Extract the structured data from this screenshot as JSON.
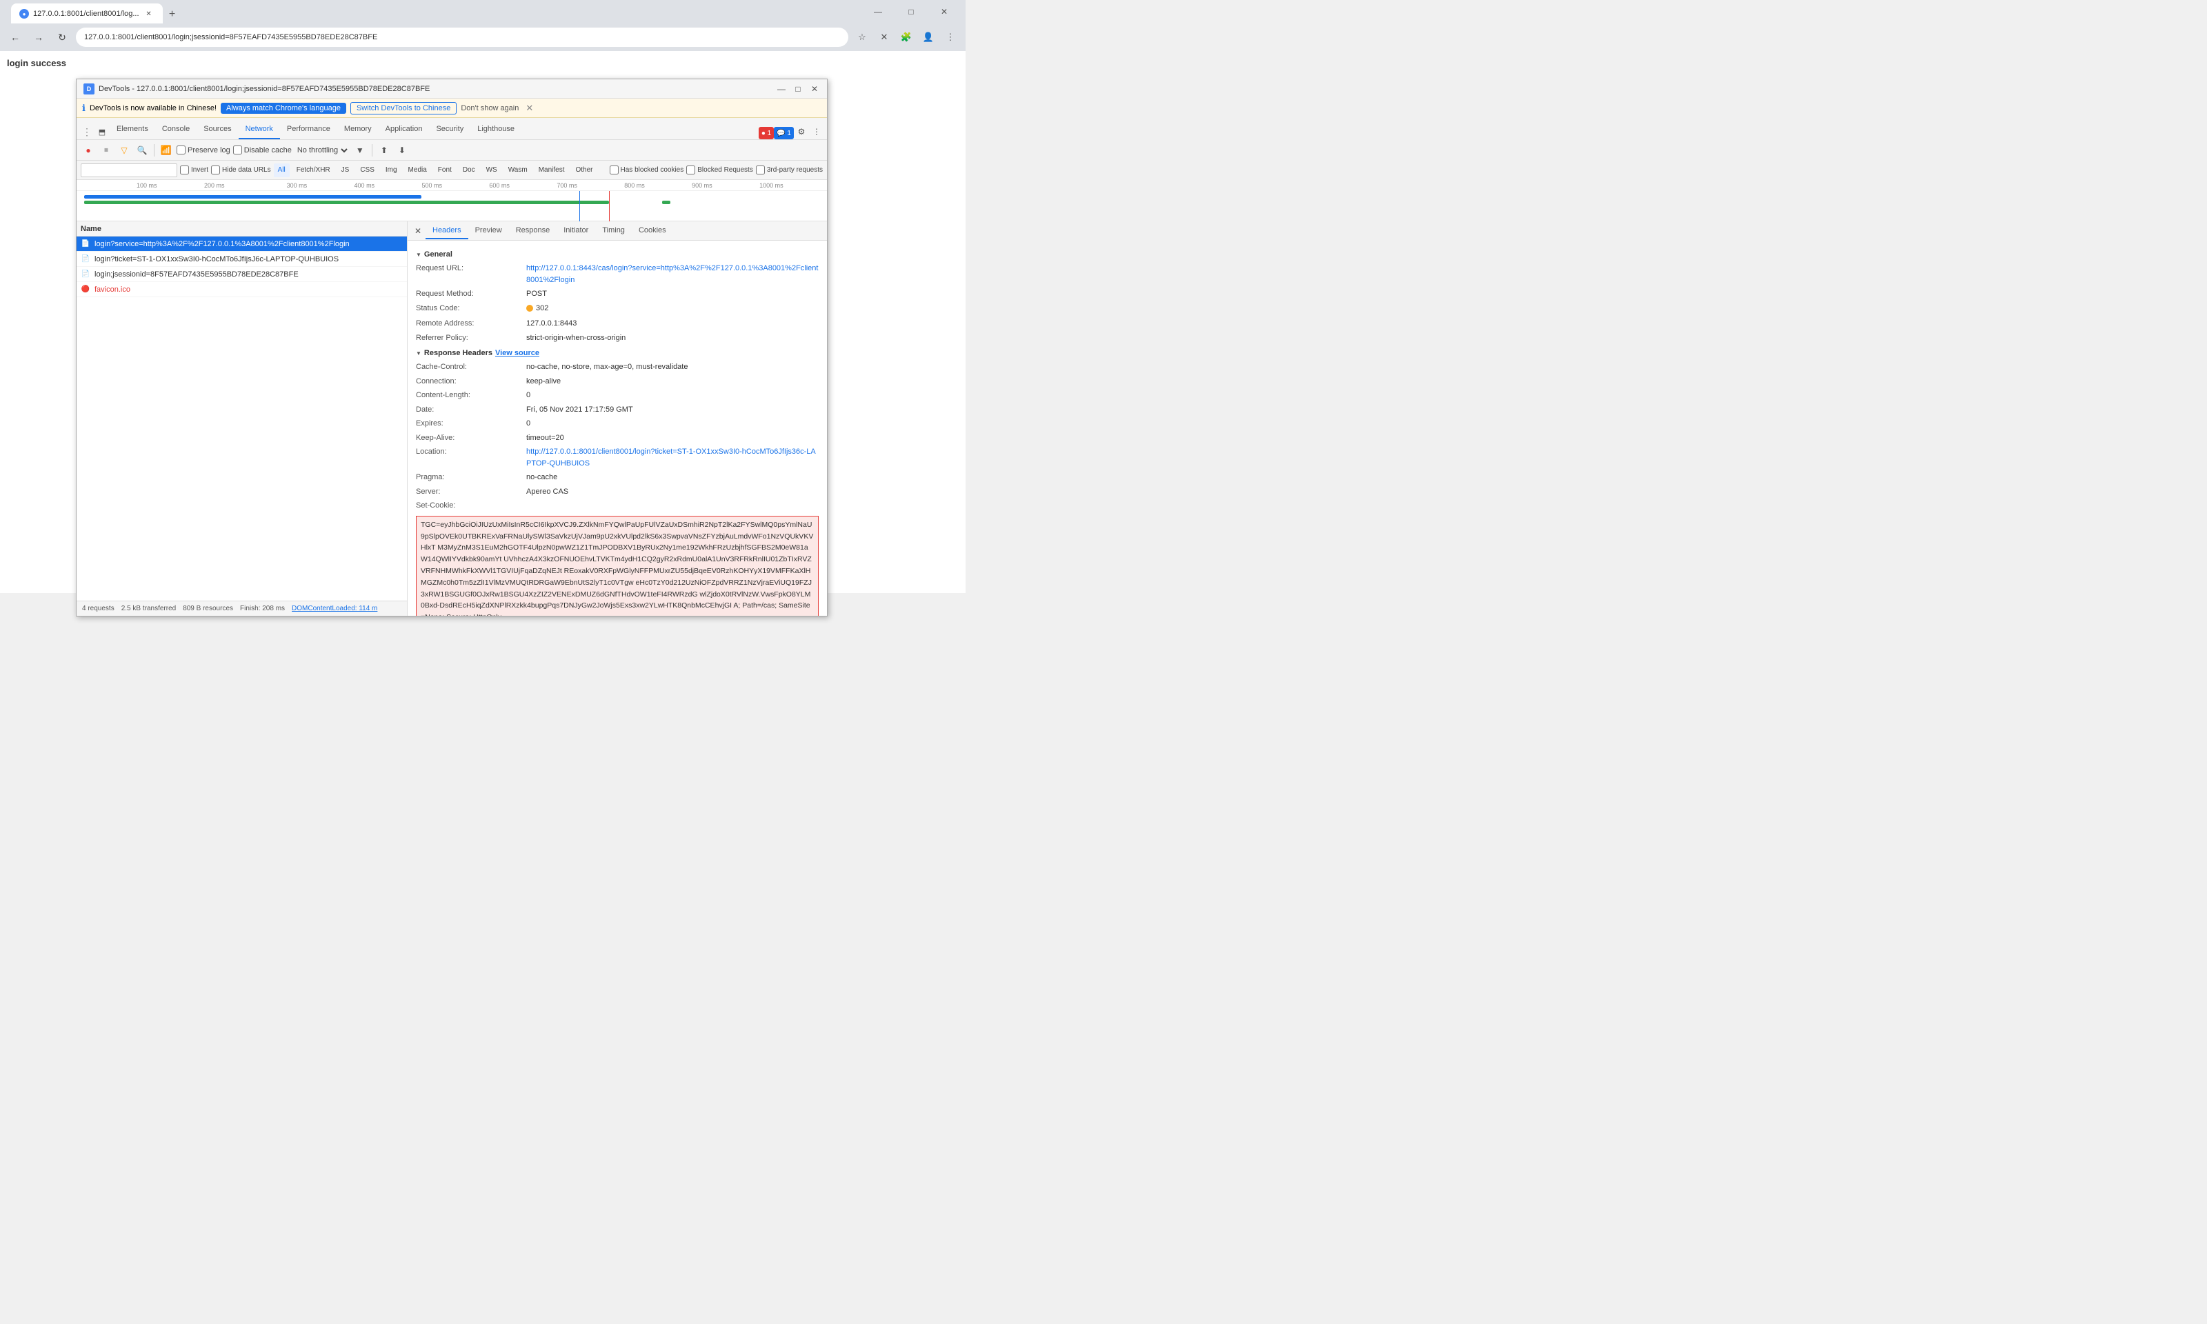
{
  "browser": {
    "tab_title": "127.0.0.1:8001/client8001/log...",
    "tab_favicon": "●",
    "address": "127.0.0.1:8001/client8001/login;jsessionid=8F57EAFD7435E5955BD78EDE28C87BFE",
    "nav_back": "←",
    "nav_forward": "→",
    "nav_reload": "↻",
    "new_tab": "+"
  },
  "page": {
    "login_success": "login success"
  },
  "devtools": {
    "title": "DevTools - 127.0.0.1:8001/client8001/login;jsessionid=8F57EAFD7435E5955BD78EDE28C87BFE",
    "lang_banner": {
      "icon": "ℹ",
      "text": "DevTools is now available in Chinese!",
      "btn1": "Always match Chrome's language",
      "btn2": "Switch DevTools to Chinese",
      "dismiss": "Don't show again"
    },
    "tabs": [
      "Elements",
      "Console",
      "Sources",
      "Network",
      "Performance",
      "Memory",
      "Application",
      "Security",
      "Lighthouse"
    ],
    "active_tab": "Network",
    "toolbar": {
      "record_tooltip": "Stop recording network log",
      "clear_tooltip": "Clear",
      "filter_tooltip": "Filter",
      "search_tooltip": "Search",
      "preserve_log": "Preserve log",
      "disable_cache": "Disable cache",
      "throttle": "No throttling",
      "import_tooltip": "Import HAR file",
      "export_tooltip": "Export HAR file"
    },
    "filter": {
      "placeholder": "",
      "invert": "Invert",
      "hide_data_urls": "Hide data URLs",
      "all": "All",
      "fetch_xhr": "Fetch/XHR",
      "js": "JS",
      "css": "CSS",
      "img": "Img",
      "media": "Media",
      "font": "Font",
      "doc": "Doc",
      "ws": "WS",
      "wasm": "Wasm",
      "manifest": "Manifest",
      "other": "Other",
      "has_blocked": "Has blocked cookies",
      "blocked_requests": "Blocked Requests",
      "third_party": "3rd-party requests"
    },
    "timeline": {
      "ticks": [
        "100 ms",
        "200 ms",
        "300 ms",
        "400 ms",
        "500 ms",
        "600 ms",
        "700 ms",
        "800 ms",
        "900 ms",
        "1000 ms"
      ]
    },
    "requests": [
      {
        "icon_type": "doc",
        "name": "login?service=http%3A%2F%2F127.0.0.1%3A8001%2Fclient8001%2Flogin",
        "selected": true
      },
      {
        "icon_type": "doc",
        "name": "login?ticket=ST-1-OX1xxSw3I0-hCocMTo6JfIjsJ6c-LAPTOP-QUHBUIOS",
        "selected": false
      },
      {
        "icon_type": "doc",
        "name": "login;jsessionid=8F57EAFD7435E5955BD78EDE28C87BFE",
        "selected": false
      },
      {
        "icon_type": "favicon",
        "name": "favicon.ico",
        "selected": false
      }
    ],
    "status_bar": {
      "requests": "4 requests",
      "transferred": "2.5 kB transferred",
      "resources": "809 B resources",
      "finish": "Finish: 208 ms",
      "dom_content": "DOMContentLoaded: 114 m"
    },
    "details": {
      "tabs": [
        "Headers",
        "Preview",
        "Response",
        "Initiator",
        "Timing",
        "Cookies"
      ],
      "active_tab": "Headers",
      "general": {
        "title": "General",
        "request_url_label": "Request URL:",
        "request_url_value": "http://127.0.0.1:8443/cas/login?service=http%3A%2F%2F127.0.0.1%3A8001%2Fclient8001%2Flogin",
        "method_label": "Request Method:",
        "method_value": "POST",
        "status_label": "Status Code:",
        "status_value": "302",
        "remote_label": "Remote Address:",
        "remote_value": "127.0.0.1:8443",
        "referrer_label": "Referrer Policy:",
        "referrer_value": "strict-origin-when-cross-origin"
      },
      "response_headers": {
        "title": "Response Headers",
        "view_source": "View source",
        "headers": [
          {
            "key": "Cache-Control:",
            "value": "no-cache, no-store, max-age=0, must-revalidate"
          },
          {
            "key": "Connection:",
            "value": "keep-alive"
          },
          {
            "key": "Content-Length:",
            "value": "0"
          },
          {
            "key": "Date:",
            "value": "Fri, 05 Nov 2021 17:17:59 GMT"
          },
          {
            "key": "Expires:",
            "value": "0"
          },
          {
            "key": "Keep-Alive:",
            "value": "timeout=20"
          },
          {
            "key": "Location:",
            "value": "http://127.0.0.1:8001/client8001/login?ticket=ST-1-OX1xxSw3I0-hCocMTo6JfIjs36c-LAPTOP-QUHBUIOS"
          },
          {
            "key": "Pragma:",
            "value": "no-cache"
          },
          {
            "key": "Server:",
            "value": "Apereo CAS"
          }
        ]
      },
      "set_cookie": {
        "key": "Set-Cookie:",
        "value": "TGC=eyJhbGciOiJIUzUxMiIsInR5cCI6IkpXVCJ9.ZXlkNmFYQwlPaUpFUlVZaUxDSmhiR2NpT2lKa2FYSwlMQ0ps YmlNaU9ppSkJNVEk0UTBKRExVaFRNaUlySWl3SaVkzUjVJam9pU2xkVUlpd2lkS6x3SwpvaVNsZFYzbjAuLmdvWFo5NzVPRUJUeXhT M3MyZnM3S1EuM2hGOTF4UlpzN0pwWZ1Z1TmJPODBXV1ByRUx2Ny1me192WkhFRzUzbjhfSGFBS2M4eW81aW14QWlIYVdkbk90amYt UVhhczA4X3kzOFNUOEhvLTVKTm4ydH1CQ2gyR2xRdmU4alA5UnV3RFRkRnlIU01ZbTIxRVZVRFNHMWhkFkXWVl1TGVHUjFqaDZqNEJt REoxakV0RXFpWGlyNFFPMUxrZU55djBqeEV0RzhKOHYyX19VMFFKaXlHMGZMc0h0Tm5zZlI1VlMzVMUQtRDRGaW9EbnUtS2lyT1c0VTgw eHc0TzY0d212UzNiOFZpdVRRZ1NzVjraEViUQ19FZJ3xRW1BSGUGf0OJxRw1BSGU4XzZIZ2VENExDMUZ6dGNfTHdvOW1teFI4RWRzdG wlZjdoX0tRVlNzW.VwsFpkO8YLM0Bxd-DsdREcH5iqZdXNPlRXzkk4bupgPqs7DNJyGw2JoWjs5Exs3xw2YLwHTK8QnbMcCEhvjGIA; Path=/cas; SameSite=None; Secure; HttpOnly"
      }
    }
  }
}
